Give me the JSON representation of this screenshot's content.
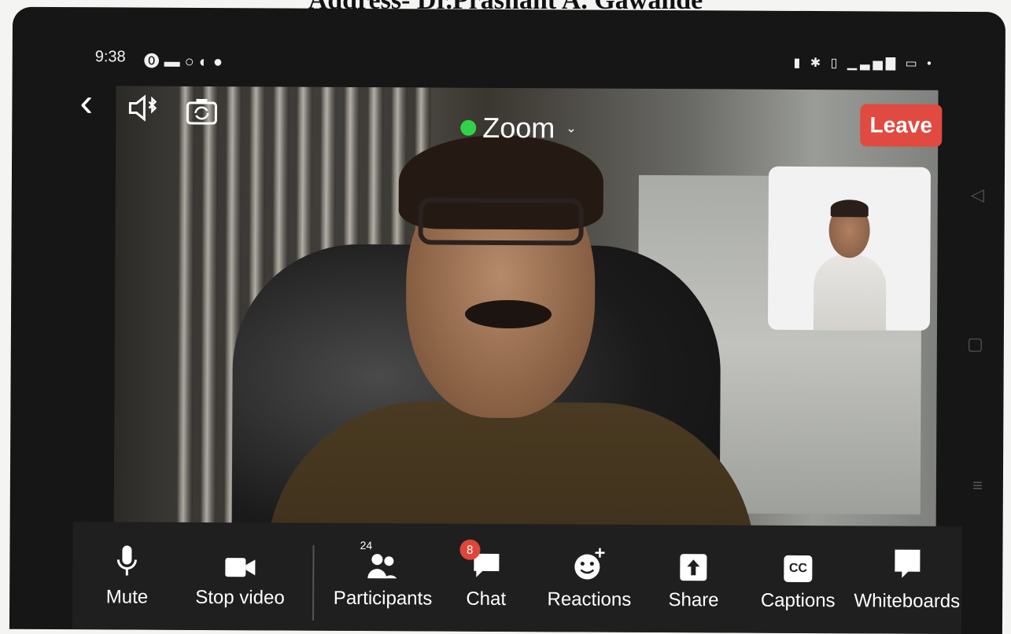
{
  "document": {
    "heading": "Address- Dr.Prashant A. Gawande"
  },
  "status_bar": {
    "time": "9:38"
  },
  "header": {
    "app_title": "Zoom",
    "leave_label": "Leave"
  },
  "toolbar": {
    "mute_label": "Mute",
    "stop_video_label": "Stop video",
    "participants_label": "Participants",
    "participants_count": "24",
    "chat_label": "Chat",
    "chat_badge": "8",
    "reactions_label": "Reactions",
    "share_label": "Share",
    "captions_label": "Captions",
    "captions_icon_text": "CC",
    "whiteboards_label": "Whiteboards"
  },
  "colors": {
    "leave": "#e04a40",
    "zoom_status_dot": "#2fd24a",
    "chat_badge": "#e0453a"
  }
}
